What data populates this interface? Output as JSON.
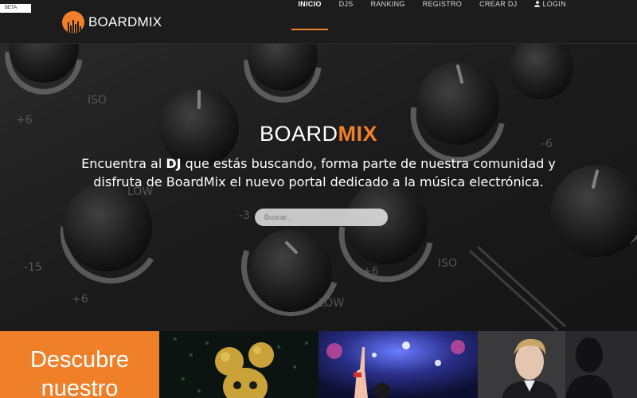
{
  "beta_label": "BETA",
  "brand": {
    "part1": "BOARD",
    "part2": "MIX",
    "accent_color": "#f07f2a"
  },
  "nav": {
    "items": [
      {
        "label": "INICIO",
        "active": true
      },
      {
        "label": "DJS"
      },
      {
        "label": "RANKING"
      },
      {
        "label": "REGISTRO"
      },
      {
        "label": "CREAR DJ"
      }
    ],
    "login": {
      "label": "LOGIN",
      "icon": "user-icon"
    }
  },
  "hero": {
    "title_part1": "BOARD",
    "title_part2": "MIX",
    "text_1": "Encuentra al ",
    "text_bold": "DJ",
    "text_2": " que estás buscando, forma parte de nuestra comunidad y disfruta de BoardMix el nuevo portal dedicado a la música electrónica.",
    "search_placeholder": "Buscar..."
  },
  "tiles": {
    "discover_text": "Descubre nuestro"
  }
}
